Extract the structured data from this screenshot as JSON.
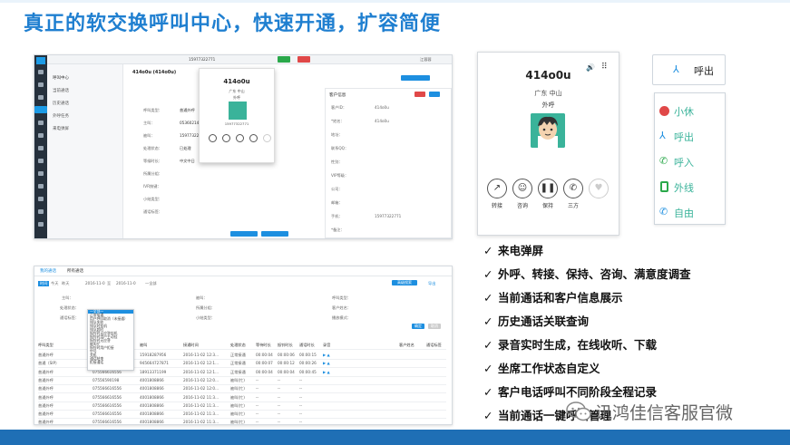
{
  "page": {
    "title": "真正的软交换呼叫中心，快速开通，扩容简便",
    "accent_color": "#1f7fd0",
    "footer_color": "#1f6fb5"
  },
  "app_window": {
    "nav": [
      "呼叫中心",
      "当前通话",
      "历史通话",
      "外呼任务",
      "来电弹屏"
    ],
    "header_title": "414o0u (414o0u)",
    "top_phone": "15977322771",
    "agent_name": "江蓉蓉",
    "fields": [
      "呼叫类型：",
      "主叫：",
      "被叫：",
      "处理状态：",
      "等候时长：",
      "所属分组：",
      "IVR按键：",
      "小结类型：",
      "通话标签：",
      "通话备注："
    ],
    "field_values": [
      "普通外呼",
      "0536021459",
      "15977322771",
      "已处理",
      "中文中日"
    ],
    "popup": {
      "name": "414o0u",
      "loc": "广东 中山",
      "dir": "外呼",
      "phone": "15977322771"
    },
    "customer_panel_title": "客户信息",
    "customer_fields": [
      "客户ID：",
      "*姓名：",
      "地址：",
      "联系QQ：",
      "性别：",
      "VIP等级：",
      "公司：",
      "邮箱：",
      "手机：",
      "*备注："
    ],
    "customer_values": [
      "414o0u",
      "414o0u",
      "15977322771"
    ]
  },
  "phone_card": {
    "name": "414o0u",
    "location": "广东 中山",
    "direction": "外呼",
    "avatar_color": "#3ab39a",
    "buttons": [
      {
        "icon": "transfer-icon",
        "label": "转接"
      },
      {
        "icon": "consult-icon",
        "label": "咨询"
      },
      {
        "icon": "hold-icon",
        "label": "保持"
      },
      {
        "icon": "three-way-icon",
        "label": "三方"
      },
      {
        "icon": "heart-icon",
        "label": ""
      }
    ]
  },
  "status_panel": {
    "current": "呼出",
    "items": [
      {
        "label": "小休",
        "color": "#e04848"
      },
      {
        "label": "呼出",
        "color": "#1d8fe0"
      },
      {
        "label": "呼入",
        "color": "#2aa84a"
      },
      {
        "label": "外线",
        "color": "#2aa84a"
      },
      {
        "label": "自由",
        "color": "#1d8fe0"
      }
    ]
  },
  "table_window": {
    "tabs": [
      "我的通话",
      "所有通话"
    ],
    "filter_labels": [
      "时间",
      "今天",
      "昨天",
      "近一",
      "主叫：",
      "被叫：",
      "呼叫类型：",
      "处理状态：",
      "所属分组：",
      "客户姓名：",
      "通话标签：",
      "小结类型：",
      "播放模式："
    ],
    "dates": [
      "2016-11-0",
      "至",
      "2016-11-0",
      "一全部"
    ],
    "buttons": [
      "高级搜索",
      "导出",
      "确定",
      "取消"
    ],
    "dropdown": [
      "一全部一",
      "正常接通",
      "用户呼叫取消（未接通）",
      "排队失败",
      "排队时挂机",
      "排队超时",
      "振铃时无应答挂机",
      "振铃时用户主动挂",
      "振铃时无应答",
      "被叫忙",
      "振铃时用户拒接",
      "空号",
      "关机",
      "通话结束",
      "拒接通话"
    ],
    "columns": [
      "呼叫类型",
      "主叫",
      "被叫",
      "接通时间",
      "处理状态",
      "等待时长",
      "振铃时长",
      "通话时长",
      "录音",
      "客户姓名",
      "通话标签"
    ],
    "rows": [
      [
        "普通外呼",
        "075566616556",
        "15918287956",
        "2016-11-02 12:3...",
        "正常接通",
        "00:00:04",
        "00:00:06",
        "00:00:15",
        "▶ ▲"
      ],
      [
        "普通（SIP）",
        "07556590198",
        "945664727871",
        "2016-11-02 12:1...",
        "正常接通",
        "00:00:07",
        "00:00:12",
        "00:00:26",
        "▶ ▲"
      ],
      [
        "普通外呼",
        "075566616556",
        "18913371199",
        "2016-11-02 12:1...",
        "正常接通",
        "00:00:04",
        "00:00:04",
        "00:00:45",
        "▶ ▲"
      ],
      [
        "普通外呼",
        "07556590198",
        "4001808866",
        "2016-11-02 12:0...",
        "被叫(忙)",
        "--",
        "--",
        "--",
        ""
      ],
      [
        "普通外呼",
        "075566616556",
        "4001808866",
        "2016-11-02 12:0...",
        "被叫(忙)",
        "--",
        "--",
        "--",
        ""
      ],
      [
        "普通外呼",
        "075566616556",
        "4001808866",
        "2016-11-02 11:3...",
        "被叫(忙)",
        "--",
        "--",
        "--",
        ""
      ],
      [
        "普通外呼",
        "075566616556",
        "4001808866",
        "2016-11-02 11:3...",
        "被叫(忙)",
        "--",
        "--",
        "--",
        ""
      ],
      [
        "普通外呼",
        "075566616556",
        "4001808866",
        "2016-11-02 11:3...",
        "被叫(忙)",
        "--",
        "--",
        "--",
        ""
      ],
      [
        "普通外呼",
        "075566616556",
        "4001808866",
        "2016-11-02 11:3...",
        "被叫(忙)",
        "--",
        "--",
        "--",
        ""
      ]
    ]
  },
  "features": [
    "来电弹屏",
    "外呼、转接、保持、咨询、满意度调查",
    "当前通话和客户信息展示",
    "历史通话关联查询",
    "录音实时生成，在线收听、下载",
    "坐席工作状态自定义",
    "客户电话呼叫不同阶段全程记录",
    "当前通话一键呼叫管理"
  ],
  "checkmark": "✓",
  "watermark": "讯鸿佳信客服官微"
}
